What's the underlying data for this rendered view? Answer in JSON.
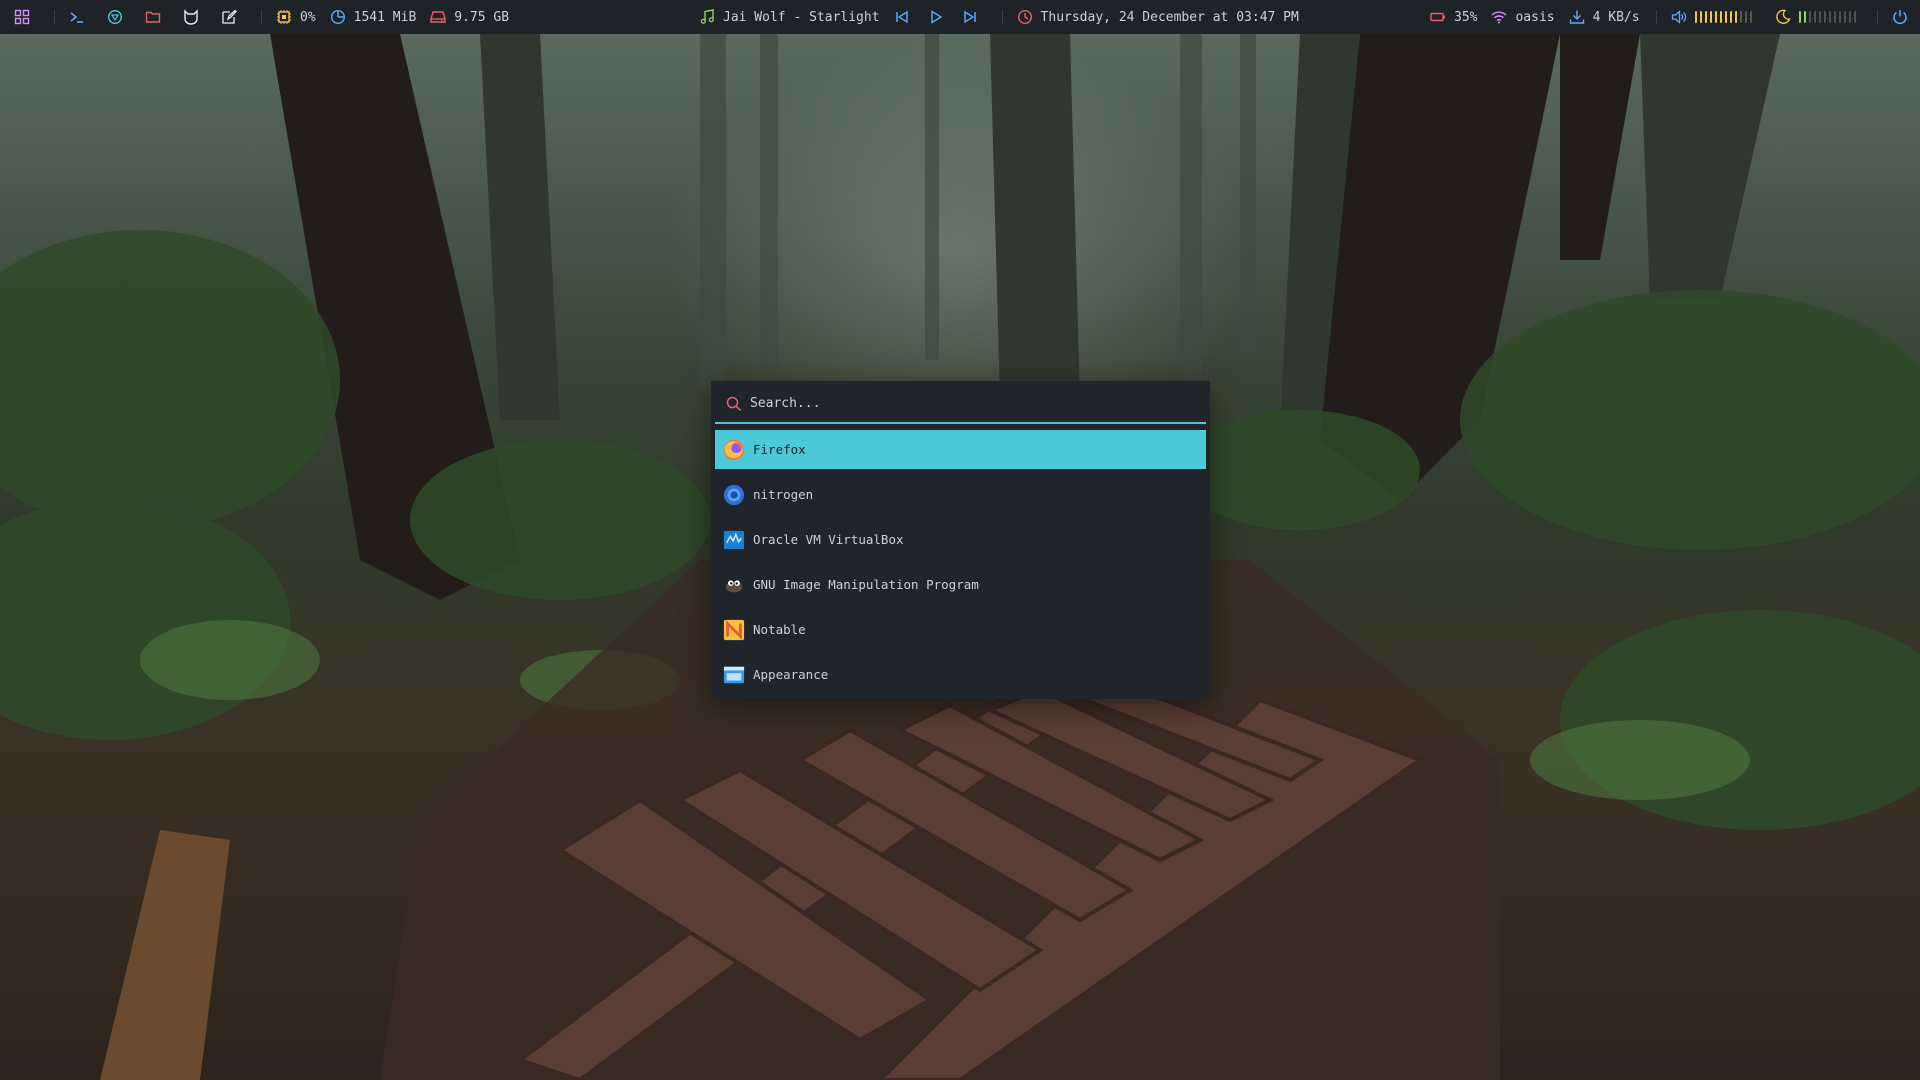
{
  "colors": {
    "bar_bg": "#1e2327",
    "accent": "#4cc9d9",
    "panel_bg": "#1f252b",
    "text": "#c9d1d9",
    "yellow": "#f3c64a",
    "red": "#ef5b6c",
    "blue": "#61a7ff",
    "green": "#8fd36e",
    "purple": "#d98dff"
  },
  "topbar": {
    "left_icons": [
      "apps-grid-icon",
      "terminal-icon",
      "browser-icon",
      "folder-icon",
      "cat-icon",
      "edit-icon"
    ],
    "cpu": {
      "icon": "cpu-icon",
      "value": "0%"
    },
    "memory": {
      "icon": "memory-pie-icon",
      "value": "1541 MiB"
    },
    "disk": {
      "icon": "disk-icon",
      "value": "9.75 GB"
    },
    "music": {
      "icon": "music-note-icon",
      "track": "Jai Wolf - Starlight"
    },
    "clock": {
      "icon": "clock-icon",
      "text": "Thursday, 24 December at 03:47 PM"
    },
    "battery": {
      "icon": "battery-icon",
      "value": "35%"
    },
    "wifi": {
      "icon": "wifi-icon",
      "ssid": "oasis"
    },
    "download": {
      "icon": "download-icon",
      "value": "4 KB/s"
    },
    "volume": {
      "icon": "volume-icon",
      "level": 0.75
    },
    "brightness": {
      "icon": "moon-icon",
      "level": 0.2
    },
    "power": {
      "icon": "power-icon"
    }
  },
  "launcher": {
    "search": {
      "placeholder": "Search...",
      "value": ""
    },
    "results": [
      {
        "label": "Firefox",
        "icon": "firefox-icon",
        "selected": true
      },
      {
        "label": "nitrogen",
        "icon": "nitrogen-icon",
        "selected": false
      },
      {
        "label": "Oracle VM VirtualBox",
        "icon": "virtualbox-icon",
        "selected": false
      },
      {
        "label": "GNU Image Manipulation Program",
        "icon": "gimp-icon",
        "selected": false
      },
      {
        "label": "Notable",
        "icon": "notable-icon",
        "selected": false
      },
      {
        "label": "Appearance",
        "icon": "appearance-icon",
        "selected": false
      }
    ]
  }
}
